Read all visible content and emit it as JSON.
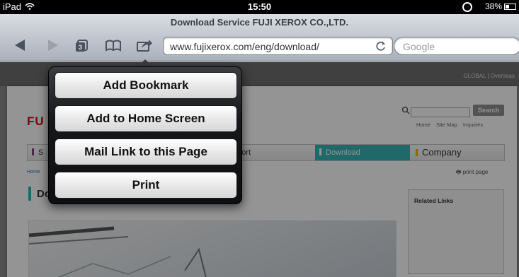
{
  "status_bar": {
    "device": "iPad",
    "time": "15:50",
    "battery": "38%"
  },
  "browser": {
    "page_title": "Download Service FUJI XEROX CO.,LTD.",
    "url": "www.fujixerox.com/eng/download/",
    "search_placeholder": "Google",
    "tab_count": "3"
  },
  "popover": {
    "items": [
      {
        "label": "Add Bookmark"
      },
      {
        "label": "Add to Home Screen"
      },
      {
        "label": "Mail Link to this Page"
      },
      {
        "label": "Print"
      }
    ]
  },
  "website": {
    "global_links": "GLOBAL  |  Overseas",
    "logo": "FU",
    "search_button": "Search",
    "util_links": [
      "Home",
      "Site Map",
      "Inquiries"
    ],
    "nav": {
      "first": "S",
      "support": "pport",
      "download": "Download",
      "company": "Company"
    },
    "breadcrumb": "Home",
    "print_page": "print page",
    "heading": "Do",
    "related_links": "Related Links"
  },
  "colors": {
    "accent_teal": "#38b6b8",
    "brand_red": "#d6001c",
    "nav_bar_purple": "#8b3a8f",
    "nav_bar_yellow": "#f0b400"
  },
  "icons": {
    "back": "back-arrow-icon",
    "forward": "forward-arrow-icon",
    "tabs": "tabs-icon",
    "bookmarks": "bookmarks-icon",
    "share": "share-icon",
    "reload": "reload-icon"
  }
}
